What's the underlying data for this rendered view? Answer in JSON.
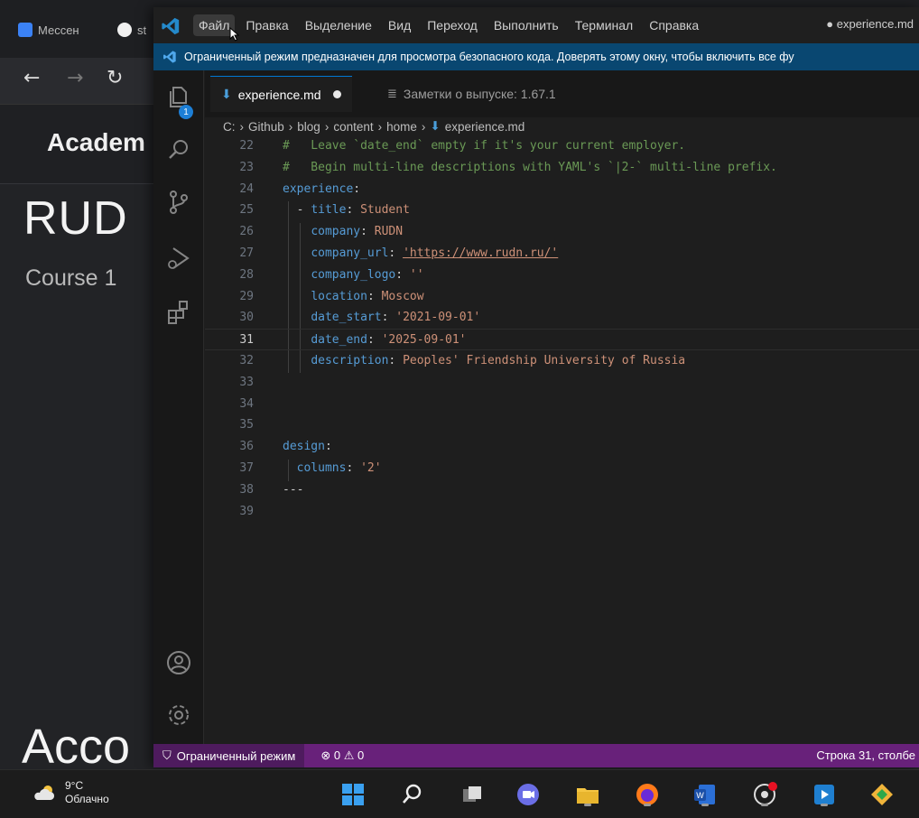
{
  "browser": {
    "tabs": [
      {
        "label": "Мессен"
      },
      {
        "label": "st"
      }
    ],
    "site_title": "Academ",
    "hero": "RUD",
    "subtitle": "Course 1",
    "section": "Acco"
  },
  "titlebar": {
    "menu": [
      "Файл",
      "Правка",
      "Выделение",
      "Вид",
      "Переход",
      "Выполнить",
      "Терминал",
      "Справка"
    ],
    "active_menu_index": 0,
    "window_title": "● experience.md"
  },
  "banner": {
    "text": "Ограниченный режим предназначен для просмотра безопасного кода. Доверять этому окну, чтобы включить все фу"
  },
  "activity": {
    "explorer_badge": "1"
  },
  "tabs": [
    {
      "label": "experience.md",
      "modified": true,
      "active": true
    },
    {
      "label": "Заметки о выпуске: 1.67.1",
      "active": false
    }
  ],
  "breadcrumb": [
    "C:",
    "Github",
    "blog",
    "content",
    "home",
    "experience.md"
  ],
  "editor": {
    "current_line": "31",
    "lines": [
      {
        "n": "22",
        "text": "#   Leave `date_end` empty if it's your current employer."
      },
      {
        "n": "23",
        "text": "#   Begin multi-line descriptions with YAML's `|2-` multi-line prefix."
      },
      {
        "n": "24",
        "key": "experience",
        "sep": ":"
      },
      {
        "n": "25",
        "indent": "  - ",
        "key": "title",
        "sep": ": ",
        "val": "Student"
      },
      {
        "n": "26",
        "indent": "    ",
        "key": "company",
        "sep": ": ",
        "val": "RUDN"
      },
      {
        "n": "27",
        "indent": "    ",
        "key": "company_url",
        "sep": ": ",
        "val": "'https://www.rudn.ru/'"
      },
      {
        "n": "28",
        "indent": "    ",
        "key": "company_logo",
        "sep": ": ",
        "val": "''"
      },
      {
        "n": "29",
        "indent": "    ",
        "key": "location",
        "sep": ": ",
        "val": "Moscow"
      },
      {
        "n": "30",
        "indent": "    ",
        "key": "date_start",
        "sep": ": ",
        "val": "'2021-09-01'"
      },
      {
        "n": "31",
        "indent": "    ",
        "key": "date_end",
        "sep": ": ",
        "val": "'2025-09-01'"
      },
      {
        "n": "32",
        "indent": "    ",
        "key": "description",
        "sep": ": ",
        "val": "Peoples' Friendship University of Russia"
      },
      {
        "n": "33"
      },
      {
        "n": "34"
      },
      {
        "n": "35"
      },
      {
        "n": "36",
        "key": "design",
        "sep": ":"
      },
      {
        "n": "37",
        "indent": "  ",
        "key": "columns",
        "sep": ": ",
        "val": "'2'"
      },
      {
        "n": "38",
        "text": "---"
      },
      {
        "n": "39"
      }
    ]
  },
  "statusbar": {
    "restricted": "Ограниченный режим",
    "errors": "0",
    "warnings": "0",
    "position": "Строка 31, столбе"
  },
  "taskbar": {
    "temperature": "9°C",
    "condition": "Облачно"
  },
  "colors": {
    "banner": "#094771",
    "statusbar": "#68217a",
    "yaml_key": "#569cd6",
    "yaml_value": "#ce9178",
    "comment": "#6a9955"
  }
}
